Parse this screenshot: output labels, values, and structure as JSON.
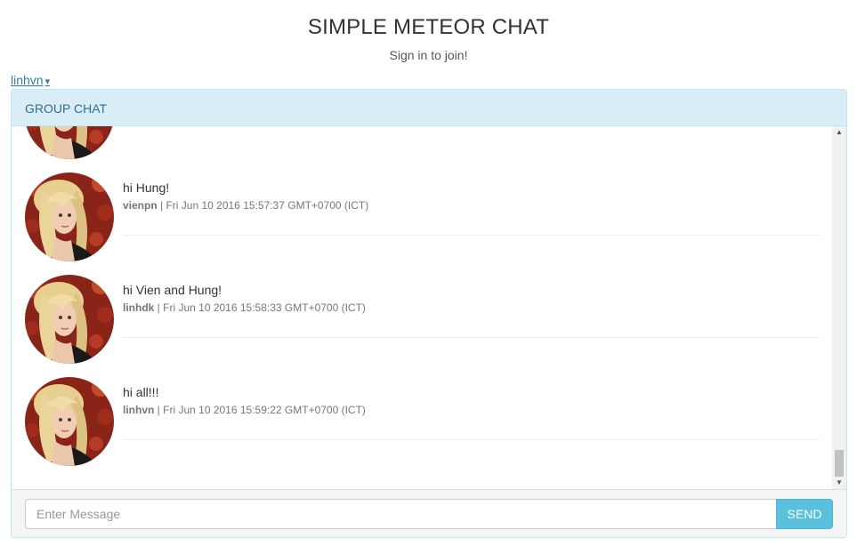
{
  "header": {
    "title": "SIMPLE METEOR CHAT",
    "subtitle": "Sign in to join!"
  },
  "user_menu": {
    "username": "linhvn",
    "caret": "▾"
  },
  "panel": {
    "heading": "GROUP CHAT"
  },
  "messages": [
    {
      "text": "hi Hung!",
      "user": "vienpn",
      "time": "Fri Jun 10 2016 15:57:37 GMT+0700 (ICT)"
    },
    {
      "text": "hi Vien and Hung!",
      "user": "linhdk",
      "time": "Fri Jun 10 2016 15:58:33 GMT+0700 (ICT)"
    },
    {
      "text": "hi all!!!",
      "user": "linhvn",
      "time": "Fri Jun 10 2016 15:59:22 GMT+0700 (ICT)"
    }
  ],
  "meta_separator": " | ",
  "composer": {
    "placeholder": "Enter Message",
    "send_label": "SEND"
  },
  "colors": {
    "heading_bg": "#d9edf7",
    "heading_text": "#31708f",
    "link": "#337ab7",
    "send_button": "#5bc0de"
  },
  "icons": {
    "scroll_up": "▲",
    "scroll_down": "▼"
  }
}
